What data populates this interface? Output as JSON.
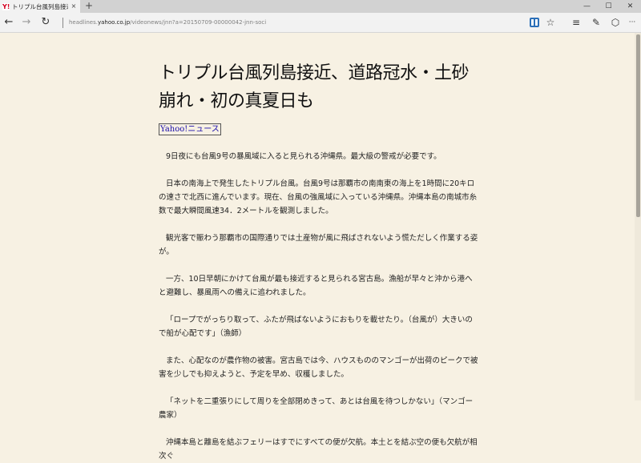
{
  "tab": {
    "favicon": "Y!",
    "title": "トリプル台風列島接近、道",
    "close": "×"
  },
  "new_tab": "+",
  "window_controls": {
    "minimize": "—",
    "maximize": "☐",
    "close": "✕"
  },
  "nav": {
    "back": "←",
    "forward": "→",
    "refresh": "↻",
    "url_pre": "headlines.",
    "url_domain": "yahoo.co.jp",
    "url_post": "/videonews/jnn?a=20150709-00000042-jnn-soci"
  },
  "toolbar": {
    "favorite": "☆",
    "hub": "≡",
    "note": "✎",
    "share": "⬡",
    "more": "···"
  },
  "article": {
    "headline": "トリプル台風列島接近、道路冠水・土砂崩れ・初の真夏日も",
    "source": "Yahoo!ニュース",
    "paragraphs": [
      "9日夜にも台風9号の暴風域に入ると見られる沖縄県。最大級の警戒が必要です。",
      "日本の南海上で発生したトリプル台風。台風9号は那覇市の南南東の海上を1時間に20キロの速さで北西に進んでいます。現在、台風の強風域に入っている沖縄県。沖縄本島の南城市糸数で最大瞬間風速34．2メートルを観測しました。",
      "観光客で賑わう那覇市の国際通りでは土産物が風に飛ばされないよう慌ただしく作業する姿が。",
      "一方、10日早朝にかけて台風が最も接近すると見られる宮古島。漁船が早々と沖から港へと避難し、暴風雨への備えに追われました。",
      "「ロープでがっちり取って、ふたが飛ばないようにおもりを載せたり。（台風が）大きいので船が心配です」（漁師）",
      "また、心配なのが農作物の被害。宮古島では今、ハウスもののマンゴーが出荷のピークで被害を少しでも抑えようと、予定を早め、収穫しました。",
      "「ネットを二重張りにして周りを全部閉めきって、あとは台風を待つしかない」（マンゴー農家）",
      "沖縄本島と離島を結ぶフェリーはすでにすべての便が欠航。本土とを結ぶ空の便も欠航が相次ぐ"
    ]
  }
}
